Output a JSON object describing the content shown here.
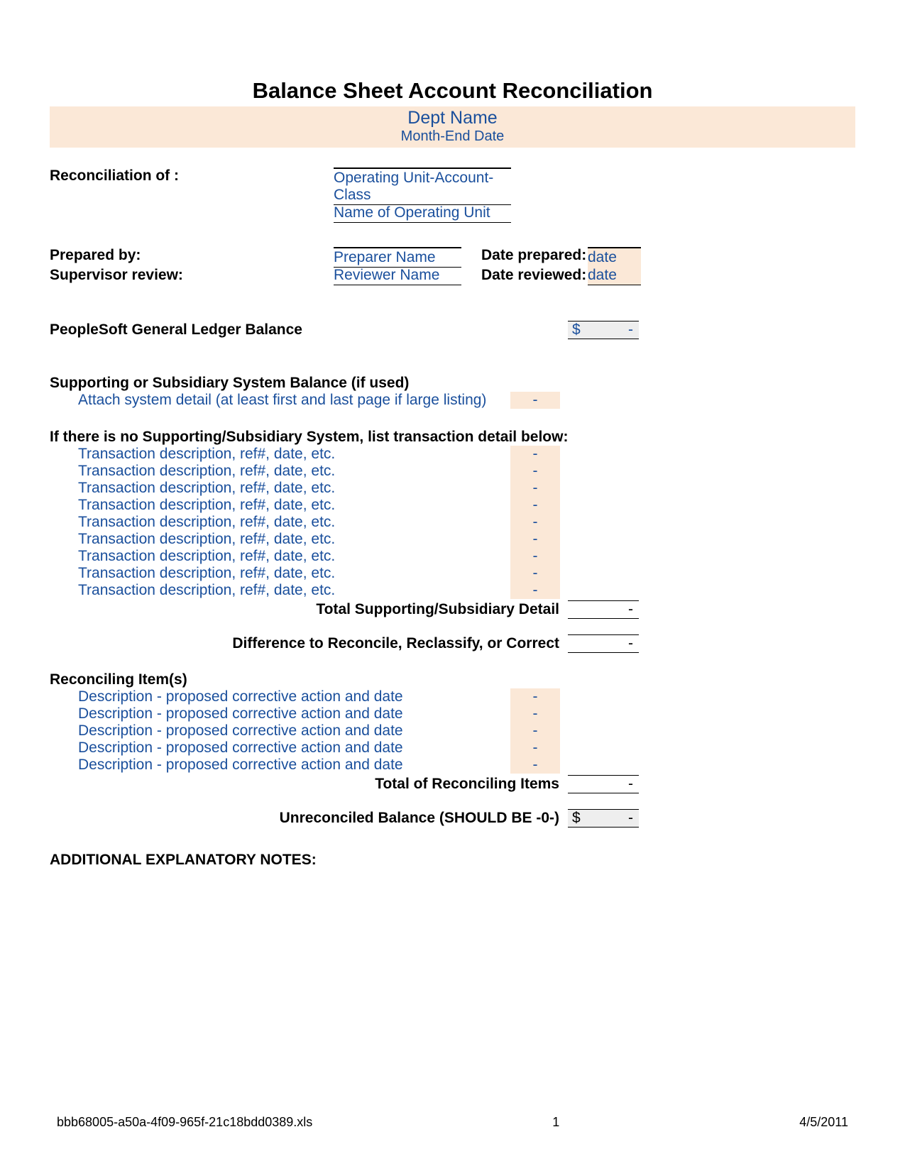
{
  "title": "Balance Sheet Account Reconciliation",
  "header": {
    "dept": "Dept Name",
    "monthEnd": "Month-End Date"
  },
  "recon": {
    "label": "Reconciliation of :",
    "value1": "Operating Unit-Account-Class",
    "value2": "Name of Operating Unit"
  },
  "prepared": {
    "label": "Prepared by:",
    "name": "Preparer Name",
    "dateLabel": "Date prepared:",
    "date": "date"
  },
  "reviewed": {
    "label": "Supervisor review:",
    "name": "Reviewer Name",
    "dateLabel": "Date reviewed:",
    "date": "date"
  },
  "gl": {
    "label": "PeopleSoft General Ledger Balance",
    "currency": "$",
    "value": "-"
  },
  "support": {
    "heading": "Supporting or Subsidiary System Balance (if used)",
    "attach": "Attach system detail (at least first and last page if large listing)",
    "attachVal": "-"
  },
  "noSupportHeading": "If there is no Supporting/Subsidiary System, list transaction detail below:",
  "transactions": [
    {
      "desc": "Transaction description, ref#, date, etc.",
      "val": "-"
    },
    {
      "desc": "Transaction description, ref#, date, etc.",
      "val": "-"
    },
    {
      "desc": "Transaction description, ref#, date, etc.",
      "val": "-"
    },
    {
      "desc": "Transaction description, ref#, date, etc.",
      "val": "-"
    },
    {
      "desc": "Transaction description, ref#, date, etc.",
      "val": "-"
    },
    {
      "desc": "Transaction description, ref#, date, etc.",
      "val": "-"
    },
    {
      "desc": "Transaction description, ref#, date, etc.",
      "val": "-"
    },
    {
      "desc": "Transaction description, ref#, date, etc.",
      "val": "-"
    },
    {
      "desc": "Transaction description, ref#, date, etc.",
      "val": "-"
    }
  ],
  "totalSupporting": {
    "label": "Total Supporting/Subsidiary Detail",
    "value": "-"
  },
  "difference": {
    "label": "Difference to Reconcile, Reclassify, or Correct",
    "value": "-"
  },
  "reconItemsHeading": "Reconciling Item(s)",
  "reconItems": [
    {
      "desc": "Description - proposed corrective action and date",
      "val": "-"
    },
    {
      "desc": "Description - proposed corrective action and date",
      "val": "-"
    },
    {
      "desc": "Description - proposed corrective action and date",
      "val": "-"
    },
    {
      "desc": "Description - proposed corrective action and date",
      "val": "-"
    },
    {
      "desc": "Description - proposed corrective action and date",
      "val": "-"
    }
  ],
  "totalRecon": {
    "label": "Total of Reconciling Items",
    "value": "-"
  },
  "unreconciled": {
    "label": "Unreconciled Balance (SHOULD BE -0-)",
    "currency": "$",
    "value": "-"
  },
  "notesHeading": "ADDITIONAL EXPLANATORY NOTES:",
  "footer": {
    "filename": "bbb68005-a50a-4f09-965f-21c18bdd0389.xls",
    "page": "1",
    "date": "4/5/2011"
  }
}
